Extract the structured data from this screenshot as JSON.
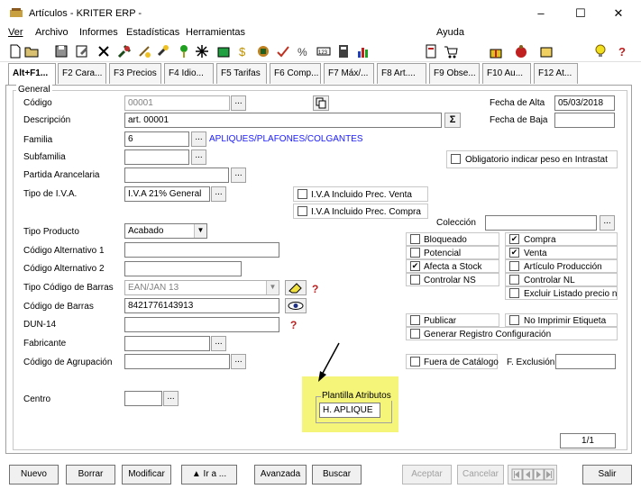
{
  "window": {
    "title": "Artículos - KRITER ERP -",
    "minimize": "–",
    "maximize": "☐",
    "close": "✕"
  },
  "menu": {
    "items": [
      "Ver",
      "Archivo",
      "Informes",
      "Estadísticas",
      "Herramientas"
    ],
    "help": "Ayuda"
  },
  "tabs": [
    "Alt+F1...",
    "F2 Cara...",
    "F3 Precios",
    "F4 Idio...",
    "F5 Tarifas",
    "F6 Comp...",
    "F7 Máx/...",
    "F8 Art....",
    "F9 Obse...",
    "F10 Au...",
    "F12 At..."
  ],
  "form": {
    "section": "General",
    "codigo_label": "Código",
    "codigo_value": "00001",
    "descripcion_label": "Descripción",
    "descripcion_value": "art. 00001",
    "sigma": "Σ",
    "familia_label": "Familia",
    "familia_value": "6",
    "familia_desc": "APLIQUES/PLAFONES/COLGANTES",
    "subfamilia_label": "Subfamilia",
    "partida_label": "Partida Arancelaria",
    "iva_label": "Tipo de I.V.A.",
    "iva_value": "I.V.A 21% General",
    "tipo_producto_label": "Tipo Producto",
    "tipo_producto_value": "Acabado",
    "cod_alt1_label": "Código Alternativo 1",
    "cod_alt2_label": "Código Alternativo 2",
    "tipo_barras_label": "Tipo Código de Barras",
    "tipo_barras_value": "EAN/JAN 13",
    "cod_barras_label": "Código de Barras",
    "cod_barras_value": "8421776143913",
    "dun_label": "DUN-14",
    "fabricante_label": "Fabricante",
    "agrupacion_label": "Código de Agrupación",
    "centro_label": "Centro",
    "fecha_alta_label": "Fecha de Alta",
    "fecha_alta_value": "05/03/2018",
    "fecha_baja_label": "Fecha de Baja",
    "intrastat_label": "Obligatorio indicar peso en Intrastat",
    "iva_venta_label": "I.V.A Incluido Prec. Venta",
    "iva_compra_label": "I.V.A Incluido Prec. Compra",
    "coleccion_label": "Colección",
    "bloqueado": "Bloqueado",
    "potencial": "Potencial",
    "afecta_stock": "Afecta a Stock",
    "controlar_ns": "Controlar NS",
    "compra": "Compra",
    "venta": "Venta",
    "articulo_produccion": "Artículo Producción",
    "controlar_nl": "Controlar NL",
    "excluir_listado": "Excluir Listado precio n",
    "publicar": "Publicar",
    "no_imprimir": "No Imprimir Etiqueta",
    "generar_registro": "Generar Registro Configuración",
    "fuera_catalogo": "Fuera de Catálogo",
    "f_exclusion_label": "F. Exclusión",
    "plantilla_label": "Plantilla Atributos",
    "plantilla_value": "H. APLIQUE",
    "page_counter": "1/1",
    "dots": "...",
    "check_mark": "✔"
  },
  "buttons": {
    "nuevo": "Nuevo",
    "borrar": "Borrar",
    "modificar": "Modificar",
    "ir_a": "▲ Ir a ...",
    "avanzada": "Avanzada",
    "buscar": "Buscar",
    "aceptar": "Aceptar",
    "cancelar": "Cancelar",
    "salir": "Salir"
  },
  "colors": {
    "highlight": "#f5f57a",
    "link_blue": "#1a1aff"
  }
}
